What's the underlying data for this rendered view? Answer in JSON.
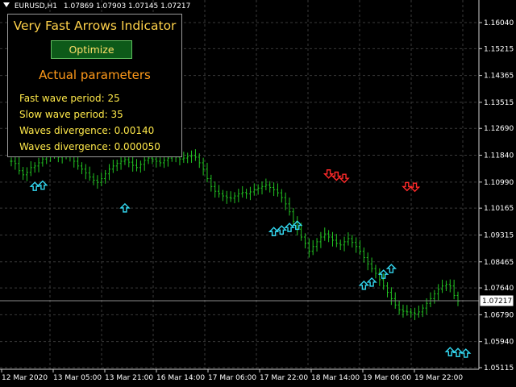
{
  "header": {
    "symbol": "EURUSD,H1",
    "ohlc": "1.07869 1.07903 1.07145 1.07217"
  },
  "panel": {
    "title": "Very Fast Arrows Indicator",
    "optimize_label": "Optimize",
    "params_title": "Actual parameters",
    "params": [
      "Fast wave period: 25",
      "Slow wave period: 35",
      "Waves divergence: 0.00140",
      "Waves divergence: 0.000050"
    ]
  },
  "price_axis": {
    "labels": [
      "1.16040",
      "1.15215",
      "1.14365",
      "1.13515",
      "1.12690",
      "1.11840",
      "1.10990",
      "1.10165",
      "1.09315",
      "1.08465",
      "1.07640",
      "1.06790",
      "1.05940",
      "1.05115"
    ],
    "current_price": "1.07217"
  },
  "time_axis": {
    "labels": [
      "12 Mar 2020",
      "13 Mar 05:00",
      "13 Mar 21:00",
      "16 Mar 14:00",
      "17 Mar 06:00",
      "17 Mar 22:00",
      "18 Mar 14:00",
      "19 Mar 06:00",
      "19 Mar 22:00"
    ]
  },
  "colors": {
    "background": "#000000",
    "grid": "#3a3a3a",
    "bars": "#22c422",
    "buy_arrow": "#33d7f0",
    "sell_arrow": "#ff2a2a"
  },
  "series": {
    "close": [
      1.1165,
      1.1158,
      1.1135,
      1.1122,
      1.113,
      1.1145,
      1.115,
      1.116,
      1.1172,
      1.1183,
      1.119,
      1.1185,
      1.1178,
      1.1183,
      1.1192,
      1.118,
      1.1165,
      1.115,
      1.114,
      1.1128,
      1.1115,
      1.1105,
      1.1098,
      1.111,
      1.1125,
      1.114,
      1.115,
      1.1158,
      1.1165,
      1.117,
      1.1162,
      1.1152,
      1.1145,
      1.1155,
      1.1168,
      1.1175,
      1.1172,
      1.1165,
      1.116,
      1.1168,
      1.1175,
      1.118,
      1.1178,
      1.1172,
      1.1175,
      1.118,
      1.1183,
      1.1178,
      1.116,
      1.114,
      1.111,
      1.1085,
      1.107,
      1.1062,
      1.1055,
      1.105,
      1.1048,
      1.1055,
      1.1062,
      1.1066,
      1.1062,
      1.1068,
      1.1075,
      1.108,
      1.1085,
      1.109,
      1.1082,
      1.1075,
      1.1065,
      1.105,
      1.103,
      1.1005,
      1.0975,
      1.095,
      1.0925,
      1.0905,
      1.088,
      1.0895,
      1.091,
      1.0925,
      1.0935,
      1.0925,
      1.0915,
      1.0905,
      1.09,
      1.091,
      1.092,
      1.0908,
      1.0895,
      1.088,
      1.086,
      1.084,
      1.0825,
      1.081,
      1.079,
      1.077,
      1.075,
      1.073,
      1.071,
      1.0695,
      1.069,
      1.0688,
      1.0685,
      1.0682,
      1.0688,
      1.07,
      1.0715,
      1.073,
      1.0745,
      1.076,
      1.077,
      1.0775,
      1.077,
      1.074,
      1.0722
    ],
    "buy_arrows": [
      [
        6,
        1.1098
      ],
      [
        8,
        1.1102
      ],
      [
        29,
        1.103
      ],
      [
        67,
        1.0955
      ],
      [
        69,
        1.096
      ],
      [
        71,
        1.0968
      ],
      [
        73,
        1.0975
      ],
      [
        90,
        1.0785
      ],
      [
        92,
        1.0795
      ],
      [
        95,
        1.082
      ],
      [
        97,
        1.0838
      ],
      [
        112,
        1.0575
      ],
      [
        114,
        1.0572
      ],
      [
        116,
        1.057
      ]
    ],
    "sell_arrows": [
      [
        81,
        1.1112
      ],
      [
        83,
        1.1105
      ],
      [
        85,
        1.1098
      ],
      [
        101,
        1.1072
      ],
      [
        103,
        1.107
      ]
    ]
  }
}
